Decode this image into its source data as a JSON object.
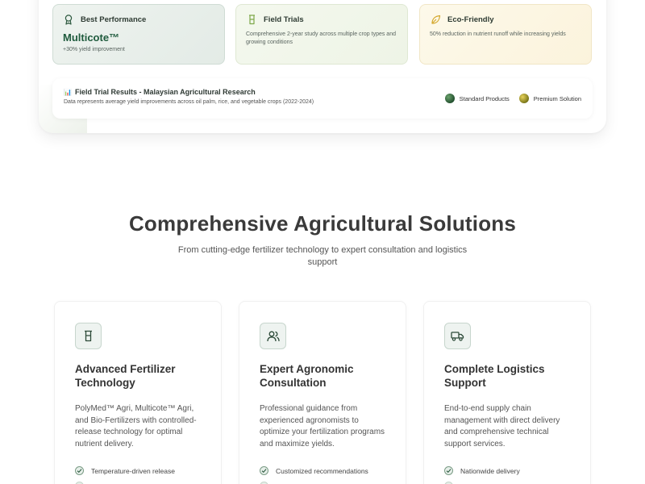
{
  "stats": [
    {
      "title": "Best Performance",
      "big": "Multicote™",
      "sub": "+30% yield improvement",
      "icon": "award-icon"
    },
    {
      "title": "Field Trials",
      "desc": "Comprehensive 2-year study across multiple crop types and growing conditions",
      "icon": "beaker-icon"
    },
    {
      "title": "Eco-Friendly",
      "desc": "50% reduction in nutrient runoff while increasing yields",
      "icon": "leaf-icon"
    }
  ],
  "trial": {
    "icon": "📊",
    "title": "Field Trial Results - Malaysian Agricultural Research",
    "subtitle": "Data represents average yield improvements across oil palm, rice, and vegetable crops (2022-2024)",
    "legend": [
      {
        "label": "Standard Products"
      },
      {
        "label": "Premium Solution"
      }
    ]
  },
  "section": {
    "title": "Comprehensive Agricultural Solutions",
    "subtitle": "From cutting-edge fertilizer technology to expert consultation and logistics support"
  },
  "features": [
    {
      "icon": "beaker-icon",
      "title": "Advanced Fertilizer Technology",
      "desc": "PolyMed™ Agri, Multicote™ Agri, and Bio-Fertilizers with controlled-release technology for optimal nutrient delivery.",
      "bullet": "Temperature-driven release"
    },
    {
      "icon": "users-icon",
      "title": "Expert Agronomic Consultation",
      "desc": "Professional guidance from experienced agronomists to optimize your fertilization programs and maximize yields.",
      "bullet": "Customized recommendations"
    },
    {
      "icon": "truck-icon",
      "title": "Complete Logistics Support",
      "desc": "End-to-end supply chain management with direct delivery and comprehensive technical support services.",
      "bullet": "Nationwide delivery"
    }
  ],
  "colors": {
    "primary": "#1f5b3d",
    "accent_gold": "#c9a820"
  }
}
